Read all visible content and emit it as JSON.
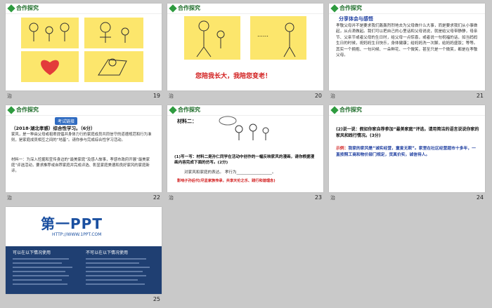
{
  "slides": [
    {
      "num": "19",
      "header": "合作探究",
      "corner": "治"
    },
    {
      "num": "20",
      "header": "合作探究",
      "corner": "治",
      "dots": "……",
      "caption": "您陪我长大，我陪您变老！"
    },
    {
      "num": "21",
      "header": "合作探究",
      "corner": "治",
      "subtitle": "分享体会与感悟",
      "body": "孝敬父母并不是要求我们轰轰烈烈地去为父母做什么大事，而是要求我们从小事做起，从点滴做起。我们可以把自己的心里话和父母说说，就是给父母带静静，母亲节、父亲节或者父母的生日时，给父母一点惊喜，或者说一句祝福的话，如当妈妈生日的时候，祝妈妈生日快乐，身体健康；给妈妈洗一次脚，给妈妈盛饭；等等。其实一个拥抱、一句问候、一朵鲜花、一个微笑，甚至只是一个微笑，都是在孝敬父母。"
    },
    {
      "num": "22",
      "header": "合作探究",
      "corner": "治",
      "tag": "考试链接",
      "q": "（2018·湖北孝感）综合性学习。（6分）",
      "p1": "家风，是一种由父母或祖辈提倡并身体力行的家庭成员共同信守的道德规范和行为准则，是家庭成员相互之间的“地基”。请你参与完成综合性学习活动。",
      "p2": "材料一：为深入挖掘和宣传身边的“最美家庭”及感人故事，孝感市政府开展“最美家庭”评选活动，要求推荐或自荐家庭并完成评选、彰显家庭美德和良好家风的家庭新评。"
    },
    {
      "num": "23",
      "header": "合作探究",
      "corner": "治",
      "m2": "材料二：",
      "q": "(1)写一写：材料二是孙仁同学在活动中创作的一幅反映家风的漫画，请你根据漫画内容完成下面的仿写。(2分)",
      "blank": "对家风和家庭的表达。                孝行为__________________。",
      "ans": "影响子孙后代(尽显家族传承，共享天伦之乐、践行和谐理念)"
    },
    {
      "num": "24",
      "header": "合作探究",
      "corner": "治",
      "q": "(2)说一说：假如你家自荐参加“最美家庭”评选，请用简洁的语言说说你家的家风和践行情况。(3分)",
      "ex_label": "示例：",
      "ex": "我家的家风是“诚实经营，童叟无欺”。家里在社区经营超市十多年，一直按照工商和物价部门规定，货真价实，诚信待人。"
    },
    {
      "num": "25",
      "logo": "第一PPT",
      "url": "HTTP://WWW.1PPT.COM",
      "can_title": "可以在以下情况使用",
      "cannot_title": "不可以在以下情况使用"
    }
  ]
}
